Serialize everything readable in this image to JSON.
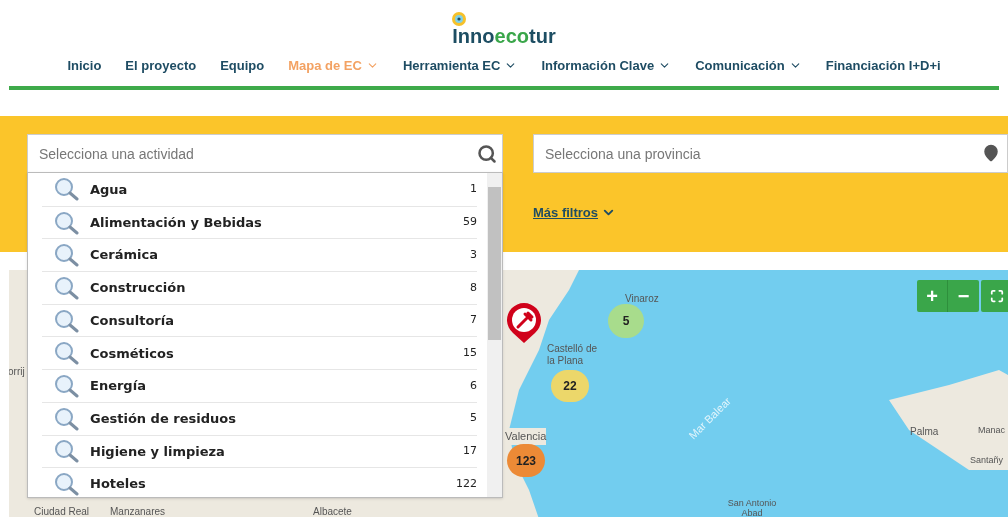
{
  "logo": {
    "text_a": "Inno",
    "text_b": "eco",
    "text_c": "tur"
  },
  "nav": [
    {
      "label": "Inicio",
      "selected": false,
      "dropdown": false
    },
    {
      "label": "El proyecto",
      "selected": false,
      "dropdown": false
    },
    {
      "label": "Equipo",
      "selected": false,
      "dropdown": false
    },
    {
      "label": "Mapa de EC",
      "selected": true,
      "dropdown": true
    },
    {
      "label": "Herramienta EC",
      "selected": false,
      "dropdown": true
    },
    {
      "label": "Información Clave",
      "selected": false,
      "dropdown": true
    },
    {
      "label": "Comunicación",
      "selected": false,
      "dropdown": true
    },
    {
      "label": "Financiación I+D+i",
      "selected": false,
      "dropdown": false
    }
  ],
  "activity_search": {
    "placeholder": "Selecciona una actividad",
    "expanded": true,
    "options": [
      {
        "label": "Agua",
        "count": "1"
      },
      {
        "label": "Alimentación y Bebidas",
        "count": "59"
      },
      {
        "label": "Cerámica",
        "count": "3"
      },
      {
        "label": "Construcción",
        "count": "8"
      },
      {
        "label": "Consultoría",
        "count": "7"
      },
      {
        "label": "Cosméticos",
        "count": "15"
      },
      {
        "label": "Energía",
        "count": "6"
      },
      {
        "label": "Gestión de residuos",
        "count": "5"
      },
      {
        "label": "Higiene y limpieza",
        "count": "17"
      },
      {
        "label": "Hoteles",
        "count": "122"
      }
    ]
  },
  "province_search": {
    "placeholder": "Selecciona una provincia"
  },
  "more_filters": "Más filtros",
  "map": {
    "place_labels": [
      {
        "text": "Vinaroz"
      },
      {
        "text": "Castelló de la Plana"
      },
      {
        "text": "orrij"
      },
      {
        "text": "Mar Balear"
      },
      {
        "text": "Palma"
      },
      {
        "text": "Manac"
      },
      {
        "text": "Valencia"
      },
      {
        "text": "Santañy"
      },
      {
        "text": "Ciudad Real"
      },
      {
        "text": "Manzanares"
      },
      {
        "text": "Albacete"
      },
      {
        "text": "San Antonio Abad"
      }
    ],
    "clusters": [
      {
        "count": "5",
        "color": "#a8dc8c"
      },
      {
        "count": "22",
        "color": "#ecd76a"
      },
      {
        "count": "123",
        "color": "#ec8a36"
      }
    ],
    "zoom_in": "+",
    "zoom_out": "−"
  }
}
